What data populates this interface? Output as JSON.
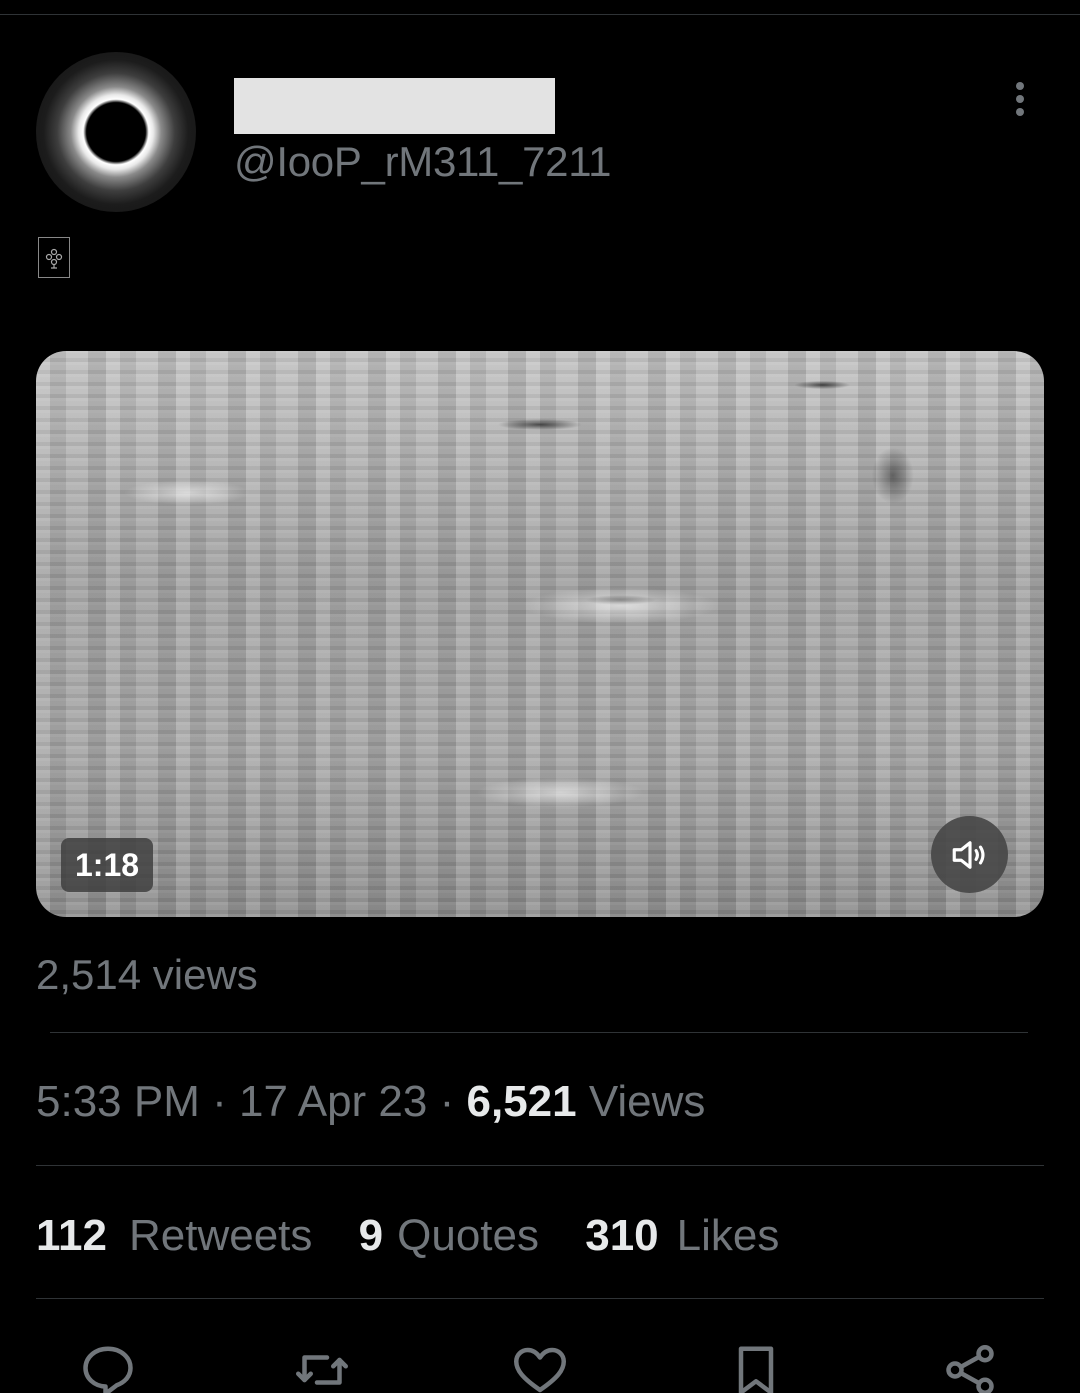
{
  "author": {
    "handle": "@IooP_rM311_7211"
  },
  "media": {
    "duration": "1:18",
    "view_count_label": "2,514 views"
  },
  "meta": {
    "time": "5:33 PM",
    "date": "17 Apr 23",
    "separator": "·",
    "views_number": "6,521",
    "views_label": "Views"
  },
  "stats": {
    "retweets_number": "112",
    "retweets_label": "Retweets",
    "quotes_number": "9",
    "quotes_label": "Quotes",
    "likes_number": "310",
    "likes_label": "Likes"
  },
  "icons": {
    "more": "more-vertical-icon",
    "volume": "volume-icon",
    "reply": "reply-icon",
    "retweet": "retweet-icon",
    "like": "heart-icon",
    "bookmark": "bookmark-icon",
    "share": "share-icon"
  },
  "colors": {
    "background": "#000000",
    "primary_text": "#e7e9ea",
    "secondary_text": "#71767b",
    "divider": "#2f3336"
  }
}
